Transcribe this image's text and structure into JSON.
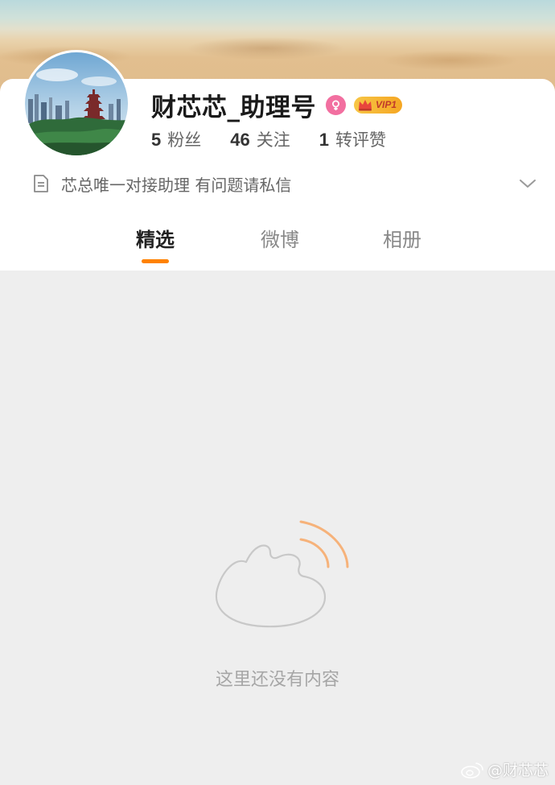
{
  "profile": {
    "name": "财芯芯_助理号",
    "vip_label": "VIP1",
    "stats": [
      {
        "number": "5",
        "label": "粉丝"
      },
      {
        "number": "46",
        "label": "关注"
      },
      {
        "number": "1",
        "label": "转评赞"
      }
    ],
    "bio": "芯总唯一对接助理 有问题请私信"
  },
  "tabs": [
    {
      "label": "精选",
      "active": true
    },
    {
      "label": "微博",
      "active": false
    },
    {
      "label": "相册",
      "active": false
    }
  ],
  "empty_state": {
    "message": "这里还没有内容"
  },
  "watermark": {
    "text": "@财芯芯"
  },
  "icons": {
    "gender": "female-symbol-icon",
    "vip": "crown-icon",
    "bio": "document-icon",
    "expand": "chevron-down-icon",
    "empty": "weibo-logo-outline-icon"
  },
  "colors": {
    "accent": "#ff8200",
    "gender_badge": "#f26fa0",
    "vip_gold": "#f5a623",
    "page_background": "#eeeeee"
  }
}
